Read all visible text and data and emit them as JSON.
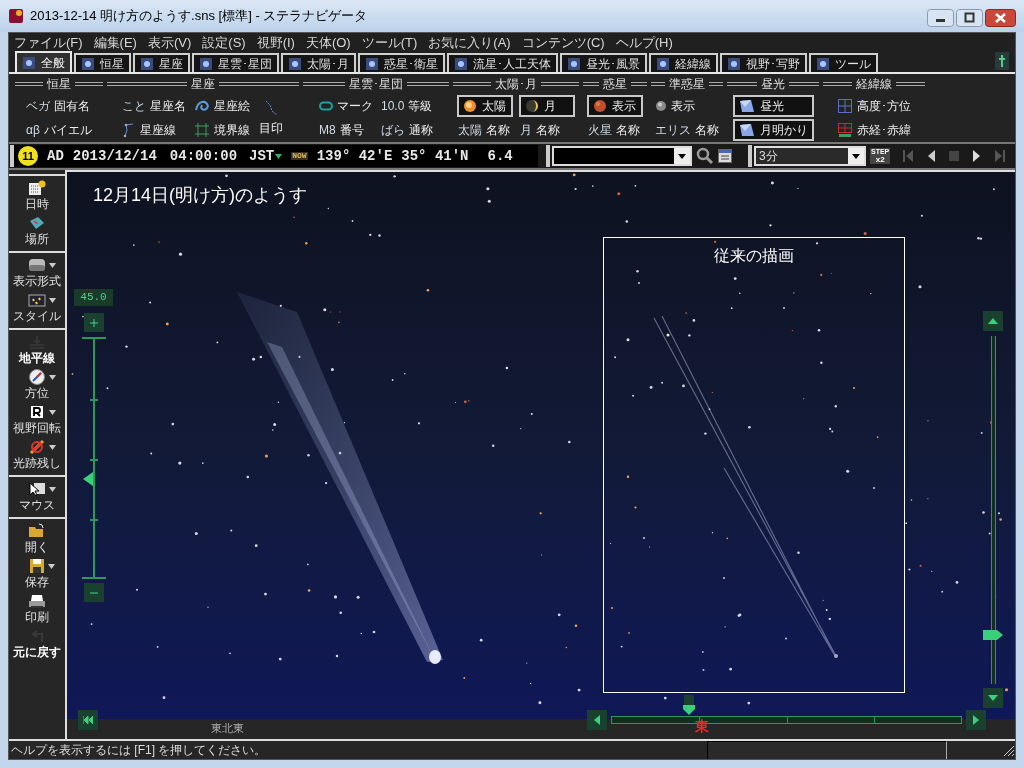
{
  "window": {
    "title": "2013-12-14 明け方のようす.sns [標準] - ステラナビゲータ"
  },
  "menu": [
    "ファイル(F)",
    "編集(E)",
    "表示(V)",
    "設定(S)",
    "視野(I)",
    "天体(O)",
    "ツール(T)",
    "お気に入り(A)",
    "コンテンツ(C)",
    "ヘルプ(H)"
  ],
  "tabs": [
    {
      "label": "全般",
      "selected": true
    },
    {
      "label": "恒星",
      "selected": false
    },
    {
      "label": "星座",
      "selected": false
    },
    {
      "label": "星雲･星団",
      "selected": false
    },
    {
      "label": "太陽･月",
      "selected": false
    },
    {
      "label": "惑星･衛星",
      "selected": false
    },
    {
      "label": "流星･人工天体",
      "selected": false
    },
    {
      "label": "昼光･風景",
      "selected": false
    },
    {
      "label": "経緯線",
      "selected": false
    },
    {
      "label": "視野･写野",
      "selected": false
    },
    {
      "label": "ツール",
      "selected": false
    }
  ],
  "ribbon": [
    {
      "title": "恒星",
      "columns": [
        [
          {
            "label": "固有名",
            "kind": "badge",
            "badge": "ベガ"
          },
          {
            "label": "バイエル",
            "kind": "badge",
            "badge": "αβ"
          }
        ]
      ]
    },
    {
      "title": "星座",
      "columns": [
        [
          {
            "label": "星座名",
            "kind": "badge",
            "badge": "こと"
          },
          {
            "label": "星座線",
            "kind": "lines"
          }
        ],
        [
          {
            "label": "星座絵",
            "kind": "figure"
          },
          {
            "label": "境界線",
            "kind": "boundary"
          }
        ],
        [
          {
            "label": "目印",
            "kind": "marker"
          }
        ]
      ]
    },
    {
      "title": "星雲･星団",
      "columns": [
        [
          {
            "label": "マーク",
            "kind": "ring"
          },
          {
            "label": "番号",
            "kind": "badge",
            "badge": "M8"
          }
        ],
        [
          {
            "label": "等級",
            "kind": "badge",
            "badge": "10.0"
          },
          {
            "label": "通称",
            "kind": "badge",
            "badge": "ばら"
          }
        ]
      ]
    },
    {
      "title": "太陽･月",
      "columns": [
        [
          {
            "label": "太陽",
            "kind": "sun"
          },
          {
            "label": "名称",
            "kind": "badge",
            "badge": "太陽"
          }
        ],
        [
          {
            "label": "月",
            "kind": "moon"
          },
          {
            "label": "名称",
            "kind": "badge",
            "badge": "月"
          }
        ]
      ]
    },
    {
      "title": "惑星",
      "columns": [
        [
          {
            "label": "表示",
            "kind": "planet"
          },
          {
            "label": "名称",
            "kind": "badge",
            "badge": "火星"
          }
        ]
      ]
    },
    {
      "title": "準惑星",
      "columns": [
        [
          {
            "label": "表示",
            "kind": "dot"
          },
          {
            "label": "名称",
            "kind": "badge",
            "badge": "エリス"
          }
        ]
      ]
    },
    {
      "title": "昼光",
      "columns": [
        [
          {
            "label": "昼光",
            "kind": "sky"
          },
          {
            "label": "月明かり",
            "kind": "sky"
          }
        ]
      ]
    },
    {
      "title": "経緯線",
      "columns": [
        [
          {
            "label": "高度･方位",
            "kind": "grid"
          },
          {
            "label": "赤経･赤緯",
            "kind": "redgrid"
          }
        ]
      ]
    }
  ],
  "time_bar": {
    "moon_age": "11",
    "era": "AD",
    "date": "2013/12/14",
    "time": "04:00:00",
    "zone": "JST",
    "now": "NOW",
    "longitude": "139° 42'E",
    "latitude": "35° 41'N",
    "limit_magnitude": "6.4",
    "step": "3分",
    "step_badge": "STEP",
    "step_factor": "x2"
  },
  "sidebar": [
    [
      {
        "label": "日時",
        "kind": "clock",
        "menu": false,
        "disabled": false
      },
      {
        "label": "場所",
        "kind": "map",
        "menu": false,
        "disabled": false
      }
    ],
    [
      {
        "label": "表示形式",
        "kind": "display",
        "menu": true,
        "disabled": false
      },
      {
        "label": "スタイル",
        "kind": "style",
        "menu": true,
        "disabled": false
      }
    ],
    [
      {
        "label": "地平線",
        "kind": "horizon",
        "menu": false,
        "disabled": true
      },
      {
        "label": "方位",
        "kind": "compass",
        "menu": true,
        "disabled": false
      },
      {
        "label": "視野回転",
        "kind": "rotate",
        "menu": true,
        "disabled": false
      },
      {
        "label": "光跡残し",
        "kind": "trail",
        "menu": true,
        "disabled": false
      }
    ],
    [
      {
        "label": "マウス",
        "kind": "mouse",
        "menu": true,
        "disabled": false
      }
    ],
    [
      {
        "label": "開く",
        "kind": "open",
        "menu": false,
        "disabled": false
      },
      {
        "label": "保存",
        "kind": "save",
        "menu": true,
        "disabled": false
      },
      {
        "label": "印刷",
        "kind": "print",
        "menu": false,
        "disabled": false
      },
      {
        "label": "元に戻す",
        "kind": "undo",
        "menu": false,
        "disabled": true
      }
    ]
  ],
  "sky_view": {
    "caption": "12月14日(明け方)のようす",
    "zoom_slider": {
      "reading": "45.0",
      "level": 0.42
    },
    "altitude_slider": {
      "level": 0.14
    },
    "azimuth_slider": {
      "level": 0.22
    },
    "directions": [
      {
        "label": "東北東",
        "kind": "minor"
      },
      {
        "label": "東",
        "kind": "cardinal"
      }
    ],
    "inset": {
      "label": "従来の描画"
    }
  },
  "status_bar": {
    "text": "ヘルプを表示するには [F1] を押してください。"
  }
}
